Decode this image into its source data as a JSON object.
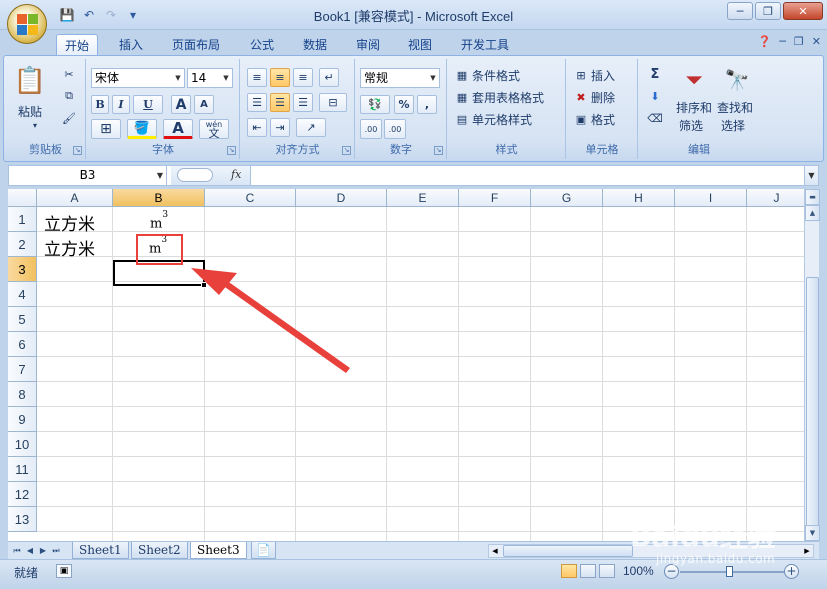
{
  "window": {
    "title": "Book1  [兼容模式] - Microsoft Excel",
    "min": "─",
    "max": "❐",
    "close": "✕"
  },
  "ribbon_tabs": [
    "开始",
    "插入",
    "页面布局",
    "公式",
    "数据",
    "审阅",
    "视图",
    "开发工具"
  ],
  "ribbon": {
    "clipboard": {
      "label": "剪贴板",
      "paste": "粘贴"
    },
    "font": {
      "label": "字体",
      "name": "宋体",
      "size": "14",
      "bold": "B",
      "italic": "I",
      "underline": "U",
      "grow": "A",
      "shrink": "A",
      "wen": "wén",
      "wen2": "文"
    },
    "alignment": {
      "label": "对齐方式"
    },
    "number": {
      "label": "数字",
      "format": "常规",
      "percent": "%",
      "comma": ",",
      "inc_dec": ".00",
      "dec_dec": ".00"
    },
    "styles": {
      "label": "样式",
      "conditional": "条件格式",
      "table": "套用表格格式",
      "cell": "单元格样式"
    },
    "cells": {
      "label": "单元格",
      "insert": "插入",
      "delete": "删除",
      "format": "格式"
    },
    "editing": {
      "label": "编辑",
      "sigma": "Σ",
      "sort": "排序和",
      "sort2": "筛选",
      "find": "查找和",
      "find2": "选择"
    }
  },
  "formula_bar": {
    "name_box": "B3",
    "fx": "fx",
    "content": ""
  },
  "columns": [
    "A",
    "B",
    "C",
    "D",
    "E",
    "F",
    "G",
    "H",
    "I",
    "J"
  ],
  "rows": [
    "1",
    "2",
    "3",
    "4",
    "5",
    "6",
    "7",
    "8",
    "9",
    "10",
    "11",
    "12",
    "13"
  ],
  "cells": {
    "A1": "立方米",
    "A2": "立方米",
    "B1_base": "m",
    "B1_sup": "3",
    "B2_base": "m",
    "B2_sup": "3"
  },
  "selected_cell": "B3",
  "sheet_tabs": [
    "Sheet1",
    "Sheet2",
    "Sheet3"
  ],
  "active_sheet": "Sheet3",
  "status": {
    "ready": "就绪",
    "zoom": "100%"
  },
  "watermark": {
    "text": "Baidu经验",
    "sub": "jingyan.baidu.com"
  },
  "colors": {
    "accent": "#15428b",
    "annotation": "#e8413b"
  }
}
